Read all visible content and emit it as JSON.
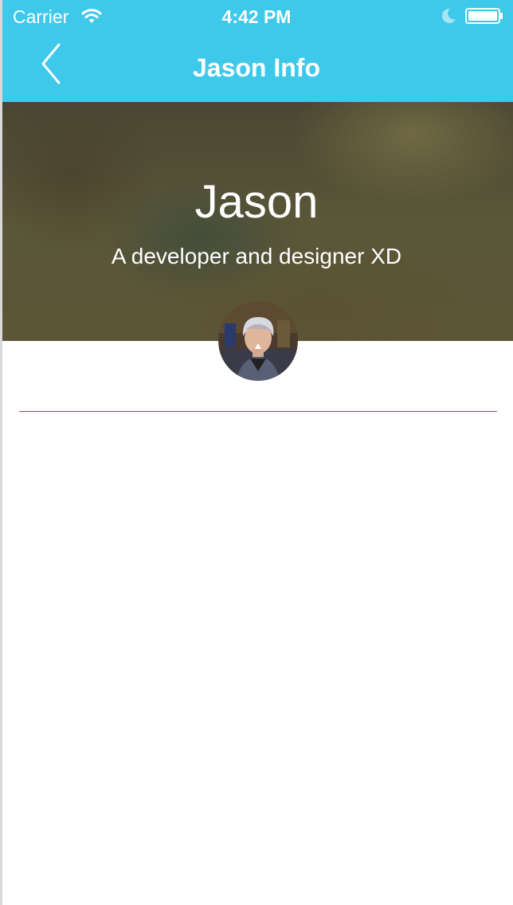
{
  "status_bar": {
    "carrier": "Carrier",
    "time": "4:42 PM",
    "icons": [
      "wifi-icon",
      "moon-icon",
      "battery-icon"
    ]
  },
  "nav": {
    "title": "Jason Info",
    "back_icon": "chevron-left-icon"
  },
  "profile": {
    "name": "Jason",
    "tagline": "A developer and designer XD"
  },
  "colors": {
    "accent": "#3ec8ea",
    "divider": "#9b3fb0",
    "text_on_accent": "#ffffff"
  }
}
